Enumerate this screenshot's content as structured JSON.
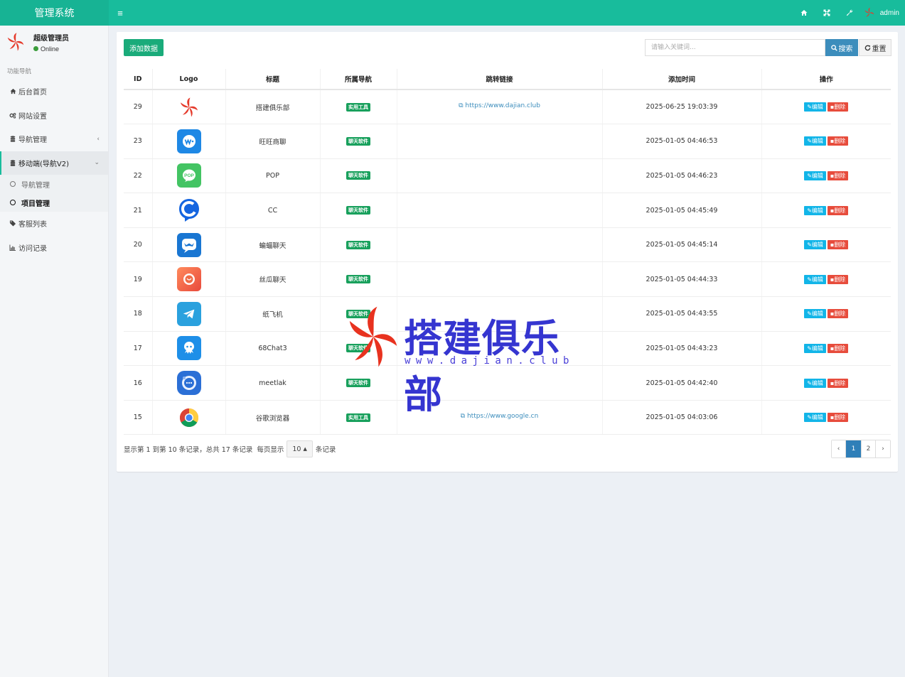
{
  "app": {
    "title": "管理系统",
    "user": "admin"
  },
  "sidebar": {
    "user_name": "超级管理员",
    "user_status": "Online",
    "section": "功能导航",
    "items": [
      {
        "label": "后台首页",
        "icon": "home-icon"
      },
      {
        "label": "网站设置",
        "icon": "cogs-icon"
      },
      {
        "label": "导航管理",
        "icon": "database-icon",
        "caret": "‹"
      },
      {
        "label": "移动端(导航V2)",
        "icon": "database-icon",
        "caret": "⌄"
      }
    ],
    "sub_items": [
      {
        "label": "导航管理"
      },
      {
        "label": "项目管理"
      }
    ],
    "items2": [
      {
        "label": "客服列表",
        "icon": "tags-icon"
      },
      {
        "label": "访问记录",
        "icon": "bar-chart-icon"
      }
    ]
  },
  "toolbar": {
    "add_label": "添加数据",
    "search_placeholder": "请输入关键词...",
    "search_label": "搜索",
    "reset_label": "重置"
  },
  "table": {
    "headers": [
      "ID",
      "Logo",
      "标题",
      "所属导航",
      "跳转链接",
      "添加时间",
      "操作"
    ],
    "edit_label": "编辑",
    "delete_label": "删除",
    "rows": [
      {
        "id": "29",
        "logo": "dajian",
        "title": "搭建俱乐部",
        "nav": "实用工具",
        "link": "https://www.dajian.club",
        "time": "2025-06-25 19:03:39"
      },
      {
        "id": "23",
        "logo": "wangwang",
        "title": "旺旺商聊",
        "nav": "聊天软件",
        "link": "",
        "time": "2025-01-05 04:46:53"
      },
      {
        "id": "22",
        "logo": "pop",
        "title": "POP",
        "nav": "聊天软件",
        "link": "",
        "time": "2025-01-05 04:46:23"
      },
      {
        "id": "21",
        "logo": "cc",
        "title": "CC",
        "nav": "聊天软件",
        "link": "",
        "time": "2025-01-05 04:45:49"
      },
      {
        "id": "20",
        "logo": "bat",
        "title": "蝙蝠聊天",
        "nav": "聊天软件",
        "link": "",
        "time": "2025-01-05 04:45:14"
      },
      {
        "id": "19",
        "logo": "sigua",
        "title": "丝瓜聊天",
        "nav": "聊天软件",
        "link": "",
        "time": "2025-01-05 04:44:33"
      },
      {
        "id": "18",
        "logo": "telegram",
        "title": "纸飞机",
        "nav": "聊天软件",
        "link": "",
        "time": "2025-01-05 04:43:55"
      },
      {
        "id": "17",
        "logo": "68chat",
        "title": "68Chat3",
        "nav": "聊天软件",
        "link": "",
        "time": "2025-01-05 04:43:23"
      },
      {
        "id": "16",
        "logo": "meetlak",
        "title": "meetlak",
        "nav": "聊天软件",
        "link": "",
        "time": "2025-01-05 04:42:40"
      },
      {
        "id": "15",
        "logo": "chrome",
        "title": "谷歌浏览器",
        "nav": "实用工具",
        "link": "https://www.google.cn",
        "time": "2025-01-05 04:03:06"
      }
    ]
  },
  "footer": {
    "info": "显示第 1 到第 10 条记录，总共 17 条记录",
    "per_page_prefix": "每页显示",
    "per_page": "10",
    "per_page_suffix": "条记录",
    "pages": [
      "‹",
      "1",
      "2",
      "›"
    ],
    "current_page": "1"
  },
  "watermark": {
    "text": "搭建俱乐部",
    "url": "www.dajian.club"
  },
  "colors": {
    "primary": "#18bc9c",
    "info": "#12b5e8",
    "danger": "#e74c3c",
    "link": "#3c8dbc",
    "tag": "#18a05c"
  }
}
